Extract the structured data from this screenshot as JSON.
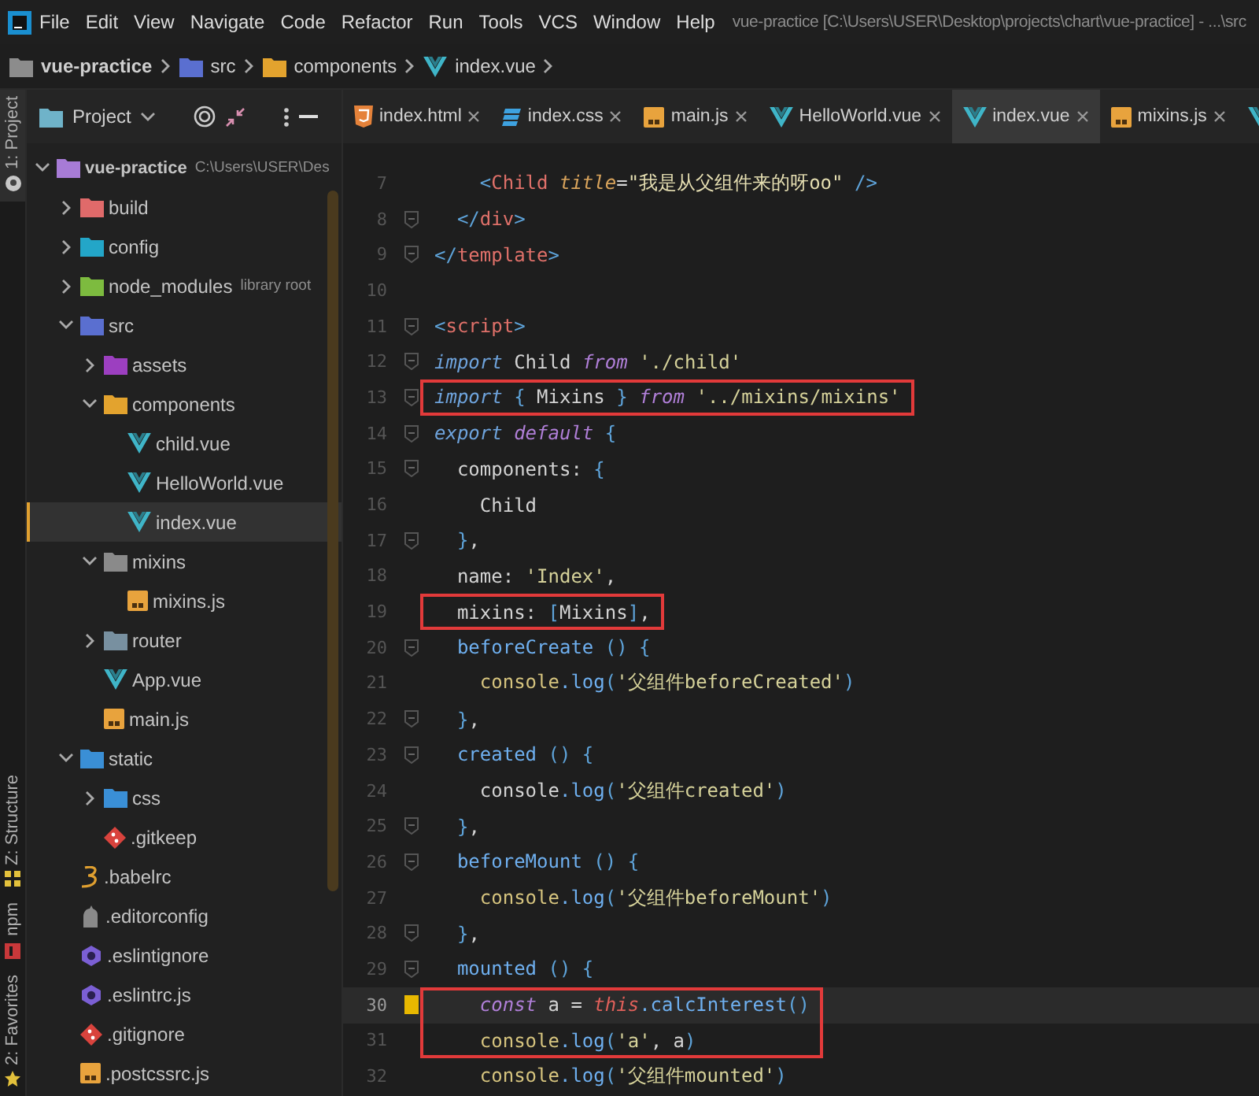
{
  "menu": [
    "File",
    "Edit",
    "View",
    "Navigate",
    "Code",
    "Refactor",
    "Run",
    "Tools",
    "VCS",
    "Window",
    "Help"
  ],
  "window": {
    "title": "vue-practice [C:\\Users\\USER\\Desktop\\projects\\chart\\vue-practice] - ...\\src"
  },
  "breadcrumb": [
    {
      "label": "vue-practice",
      "kind": "folder",
      "color": "#8c8c8c"
    },
    {
      "label": "src",
      "kind": "folder",
      "color": "#5a6fd0"
    },
    {
      "label": "components",
      "kind": "folder",
      "color": "#e3a32e"
    },
    {
      "label": "index.vue",
      "kind": "vue"
    }
  ],
  "tool_stripe": {
    "top": [
      {
        "label": "1: Project",
        "kind": "project",
        "selected": true
      }
    ],
    "bottom": [
      {
        "label": "Z: Structure",
        "kind": "structure",
        "selected": false
      },
      {
        "label": "npm",
        "kind": "npm",
        "selected": false
      },
      {
        "label": "2: Favorites",
        "kind": "favorites",
        "selected": false
      }
    ]
  },
  "project_panel": {
    "title": "Project"
  },
  "tree": [
    {
      "label": "vue-practice",
      "path": "C:\\Users\\USER\\Des",
      "kind": "folder",
      "color": "#a77bd6",
      "expanded": true,
      "selected": false,
      "children": [
        {
          "label": "build",
          "kind": "folder",
          "color": "#e06a6a",
          "expanded": false,
          "selected": false
        },
        {
          "label": "config",
          "kind": "folder",
          "color": "#23a6c8",
          "expanded": false,
          "selected": false
        },
        {
          "label": "node_modules",
          "hint": "library root",
          "kind": "folder",
          "color": "#7dbb3f",
          "expanded": false,
          "selected": false
        },
        {
          "label": "src",
          "kind": "folder",
          "color": "#5a6fd0",
          "expanded": true,
          "selected": false,
          "children": [
            {
              "label": "assets",
              "kind": "folder",
              "color": "#9c3fc0",
              "expanded": false,
              "selected": false
            },
            {
              "label": "components",
              "kind": "folder",
              "color": "#e3a32e",
              "expanded": true,
              "selected": false,
              "children": [
                {
                  "label": "child.vue",
                  "kind": "vue",
                  "selected": false
                },
                {
                  "label": "HelloWorld.vue",
                  "kind": "vue",
                  "selected": false
                },
                {
                  "label": "index.vue",
                  "kind": "vue",
                  "selected": true
                }
              ]
            },
            {
              "label": "mixins",
              "kind": "folder",
              "color": "#8a8a8a",
              "expanded": true,
              "selected": false,
              "children": [
                {
                  "label": "mixins.js",
                  "kind": "js",
                  "selected": false
                }
              ]
            },
            {
              "label": "router",
              "kind": "folder",
              "color": "#7890a0",
              "expanded": false,
              "selected": false
            },
            {
              "label": "App.vue",
              "kind": "vue",
              "selected": false
            },
            {
              "label": "main.js",
              "kind": "js",
              "selected": false
            }
          ]
        },
        {
          "label": "static",
          "kind": "folder",
          "color": "#3a8fd6",
          "expanded": true,
          "selected": false,
          "children": [
            {
              "label": "css",
              "kind": "folder",
              "color": "#3a8fd6",
              "expanded": false,
              "selected": false
            },
            {
              "label": ".gitkeep",
              "kind": "git",
              "selected": false
            }
          ]
        },
        {
          "label": ".babelrc",
          "kind": "babel",
          "selected": false
        },
        {
          "label": ".editorconfig",
          "kind": "editorconfig",
          "selected": false
        },
        {
          "label": ".eslintignore",
          "kind": "eslint",
          "selected": false
        },
        {
          "label": ".eslintrc.js",
          "kind": "eslint",
          "selected": false
        },
        {
          "label": ".gitignore",
          "kind": "git",
          "selected": false
        },
        {
          "label": ".postcssrc.js",
          "kind": "js",
          "selected": false
        }
      ]
    }
  ],
  "tabs": [
    {
      "label": "index.html",
      "kind": "html",
      "selected": false
    },
    {
      "label": "index.css",
      "kind": "css",
      "selected": false
    },
    {
      "label": "main.js",
      "kind": "js",
      "selected": false
    },
    {
      "label": "HelloWorld.vue",
      "kind": "vue",
      "selected": false
    },
    {
      "label": "index.vue",
      "kind": "vue",
      "selected": true
    },
    {
      "label": "mixins.js",
      "kind": "js",
      "selected": false
    },
    {
      "kind": "vue",
      "selected": false
    }
  ],
  "code": {
    "lines": [
      {
        "number": "7",
        "tokens": [
          {
            "text": "    <",
            "kind": "punct"
          },
          {
            "text": "Child ",
            "kind": "tag"
          },
          {
            "text": "title",
            "kind": "attr"
          },
          {
            "text": "=",
            "kind": "text"
          },
          {
            "text": "\"我是从父组件来的呀oo\"",
            "kind": "attr_value"
          },
          {
            "text": " />",
            "kind": "punct"
          }
        ]
      },
      {
        "number": "8",
        "fold": true,
        "tokens": [
          {
            "text": "  </",
            "kind": "punct"
          },
          {
            "text": "div",
            "kind": "tag"
          },
          {
            "text": ">",
            "kind": "punct"
          }
        ]
      },
      {
        "number": "9",
        "fold": true,
        "tokens": [
          {
            "text": "</",
            "kind": "punct"
          },
          {
            "text": "template",
            "kind": "tag"
          },
          {
            "text": ">",
            "kind": "punct"
          }
        ]
      },
      {
        "number": "10"
      },
      {
        "number": "11",
        "fold": true,
        "tokens": [
          {
            "text": "<",
            "kind": "punct"
          },
          {
            "text": "script",
            "kind": "tag"
          },
          {
            "text": ">",
            "kind": "punct"
          }
        ]
      },
      {
        "number": "12",
        "fold": true,
        "tokens": [
          {
            "text": "import",
            "kind": "keyword"
          },
          {
            "text": " Child ",
            "kind": "text"
          },
          {
            "text": "from ",
            "kind": "keyword2"
          },
          {
            "text": "'./child'",
            "kind": "string"
          }
        ]
      },
      {
        "number": "13",
        "fold": true,
        "boxed": true,
        "tokens": [
          {
            "text": "import",
            "kind": "keyword"
          },
          {
            "text": " { ",
            "kind": "punct"
          },
          {
            "text": "Mixins",
            "kind": "text"
          },
          {
            "text": " } ",
            "kind": "punct"
          },
          {
            "text": "from ",
            "kind": "keyword2"
          },
          {
            "text": "'../mixins/mixins'",
            "kind": "string"
          }
        ]
      },
      {
        "number": "14",
        "fold": true,
        "tokens": [
          {
            "text": "export ",
            "kind": "keyword"
          },
          {
            "text": "default",
            "kind": "keyword2"
          },
          {
            "text": " {",
            "kind": "punct"
          }
        ]
      },
      {
        "number": "15",
        "fold": true,
        "tokens": [
          {
            "text": "  components: ",
            "kind": "text"
          },
          {
            "text": "{",
            "kind": "punct"
          }
        ]
      },
      {
        "number": "16",
        "tokens": [
          {
            "text": "    Child",
            "kind": "text"
          }
        ]
      },
      {
        "number": "17",
        "fold": true,
        "tokens": [
          {
            "text": "  }",
            "kind": "punct"
          },
          {
            "text": ",",
            "kind": "text"
          }
        ]
      },
      {
        "number": "18",
        "tokens": [
          {
            "text": "  name: ",
            "kind": "text"
          },
          {
            "text": "'Index'",
            "kind": "string"
          },
          {
            "text": ",",
            "kind": "text"
          }
        ]
      },
      {
        "number": "19",
        "boxed": true,
        "tokens": [
          {
            "text": "  mixins: ",
            "kind": "text"
          },
          {
            "text": "[",
            "kind": "punct"
          },
          {
            "text": "Mixins",
            "kind": "text"
          },
          {
            "text": "]",
            "kind": "punct"
          },
          {
            "text": ",",
            "kind": "text"
          }
        ]
      },
      {
        "number": "20",
        "fold": true,
        "tokens": [
          {
            "text": "  beforeCreate",
            "kind": "method"
          },
          {
            "text": " () {",
            "kind": "punct"
          }
        ]
      },
      {
        "number": "21",
        "tokens": [
          {
            "text": "    console",
            "kind": "object"
          },
          {
            "text": ".log",
            "kind": "method"
          },
          {
            "text": "(",
            "kind": "punct"
          },
          {
            "text": "'父组件beforeCreated'",
            "kind": "string"
          },
          {
            "text": ")",
            "kind": "punct"
          }
        ]
      },
      {
        "number": "22",
        "fold": true,
        "tokens": [
          {
            "text": "  }",
            "kind": "punct"
          },
          {
            "text": ",",
            "kind": "text"
          }
        ]
      },
      {
        "number": "23",
        "fold": true,
        "tokens": [
          {
            "text": "  created",
            "kind": "method"
          },
          {
            "text": " () {",
            "kind": "punct"
          }
        ]
      },
      {
        "number": "24",
        "tokens": [
          {
            "text": "    console",
            "kind": "text"
          },
          {
            "text": ".log",
            "kind": "method"
          },
          {
            "text": "(",
            "kind": "punct"
          },
          {
            "text": "'父组件created'",
            "kind": "string"
          },
          {
            "text": ")",
            "kind": "punct"
          }
        ]
      },
      {
        "number": "25",
        "fold": true,
        "tokens": [
          {
            "text": "  }",
            "kind": "punct"
          },
          {
            "text": ",",
            "kind": "text"
          }
        ]
      },
      {
        "number": "26",
        "fold": true,
        "tokens": [
          {
            "text": "  beforeMount",
            "kind": "method"
          },
          {
            "text": " () {",
            "kind": "punct"
          }
        ]
      },
      {
        "number": "27",
        "tokens": [
          {
            "text": "    console",
            "kind": "object"
          },
          {
            "text": ".log",
            "kind": "method"
          },
          {
            "text": "(",
            "kind": "punct"
          },
          {
            "text": "'父组件beforeMount'",
            "kind": "string"
          },
          {
            "text": ")",
            "kind": "punct"
          }
        ]
      },
      {
        "number": "28",
        "fold": true,
        "tokens": [
          {
            "text": "  }",
            "kind": "punct"
          },
          {
            "text": ",",
            "kind": "text"
          }
        ]
      },
      {
        "number": "29",
        "fold": true,
        "tokens": [
          {
            "text": "  mounted",
            "kind": "method"
          },
          {
            "text": " () {",
            "kind": "punct"
          }
        ]
      },
      {
        "number": "30",
        "current": true,
        "bookmark": true,
        "boxed": true,
        "tokens": [
          {
            "text": "    const",
            "kind": "keyword2"
          },
          {
            "text": " a = ",
            "kind": "text"
          },
          {
            "text": "this",
            "kind": "this"
          },
          {
            "text": ".calcInterest",
            "kind": "method"
          },
          {
            "text": "()",
            "kind": "punct"
          }
        ]
      },
      {
        "number": "31",
        "boxed": true,
        "tokens": [
          {
            "text": "    console",
            "kind": "object"
          },
          {
            "text": ".log",
            "kind": "method"
          },
          {
            "text": "(",
            "kind": "punct"
          },
          {
            "text": "'a'",
            "kind": "string"
          },
          {
            "text": ", a",
            "kind": "text"
          },
          {
            "text": ")",
            "kind": "punct"
          }
        ]
      },
      {
        "number": "32",
        "tokens": [
          {
            "text": "    console",
            "kind": "object"
          },
          {
            "text": ".log",
            "kind": "method"
          },
          {
            "text": "(",
            "kind": "punct"
          },
          {
            "text": "'父组件mounted'",
            "kind": "string"
          },
          {
            "text": ")",
            "kind": "punct"
          }
        ]
      }
    ]
  }
}
